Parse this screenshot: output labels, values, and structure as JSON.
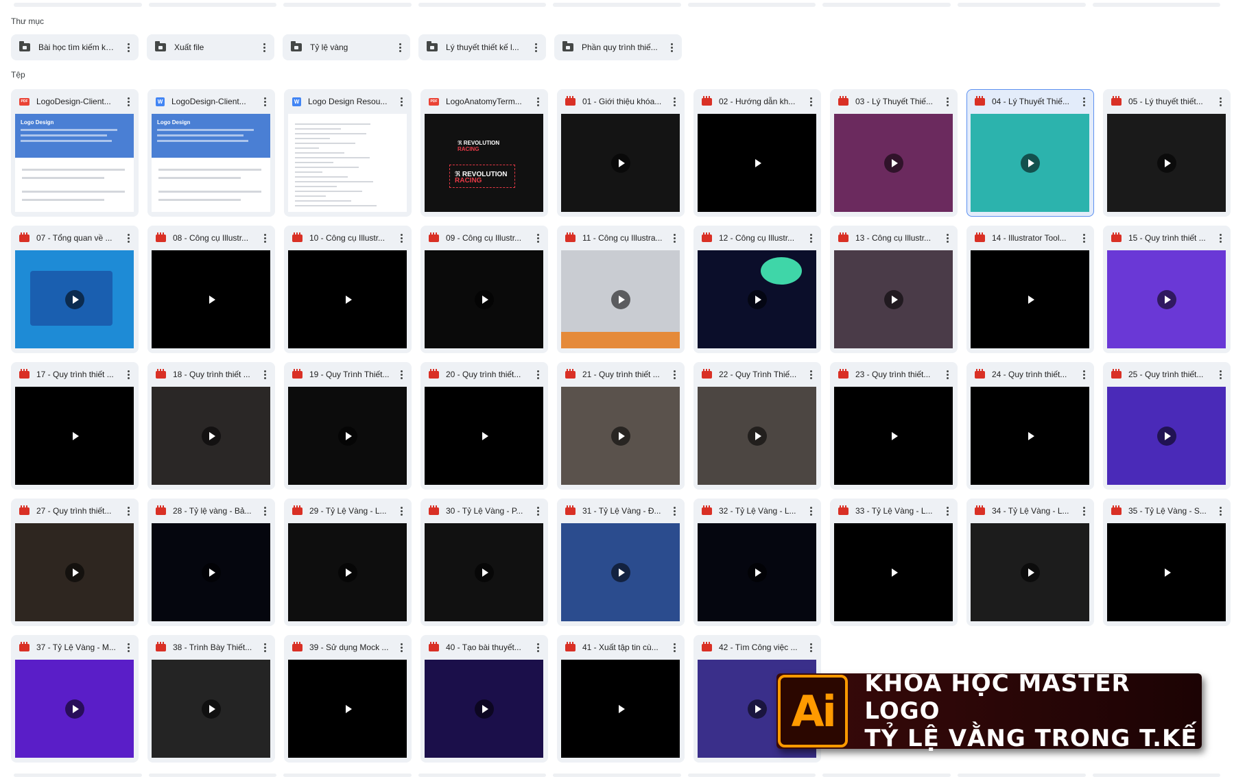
{
  "sections": {
    "folders_label": "Thư mục",
    "files_label": "Tệp"
  },
  "folders": [
    {
      "name": "Bài học tìm kiếm kh..."
    },
    {
      "name": "Xuất file"
    },
    {
      "name": "Tỷ lệ vàng"
    },
    {
      "name": "Lý thuyết thiết kế l..."
    },
    {
      "name": "Phần quy trình thiế..."
    }
  ],
  "files": [
    {
      "title": "LogoDesign-Client...",
      "type": "pdf",
      "thumb": "doc-blue"
    },
    {
      "title": "LogoDesign-Client...",
      "type": "word",
      "thumb": "doc-blue"
    },
    {
      "title": "Logo Design Resou...",
      "type": "word",
      "thumb": "doc-white"
    },
    {
      "title": "LogoAnatomyTerm...",
      "type": "pdf",
      "thumb": "anatomy"
    },
    {
      "title": "01 - Giới thiệu khóa...",
      "type": "video",
      "thumb": "#141414"
    },
    {
      "title": "02 - Hướng dẫn kh...",
      "type": "video",
      "thumb": "#000000"
    },
    {
      "title": "03 - Lý Thuyết Thiế...",
      "type": "video",
      "thumb": "#6b2a5e"
    },
    {
      "title": "04 - Lý Thuyết Thiế...",
      "type": "video",
      "thumb": "#2cb3ad",
      "selected": true
    },
    {
      "title": "05 - Lý thuyết thiết...",
      "type": "video",
      "thumb": "#1a1a1a"
    },
    {
      "title": "07 - Tổng quan về ...",
      "type": "video",
      "thumb": "#1e8bd6"
    },
    {
      "title": "08 - Công cụ Illustr...",
      "type": "video",
      "thumb": "#000000"
    },
    {
      "title": "10 - Công cụ Illustr...",
      "type": "video",
      "thumb": "#000000"
    },
    {
      "title": "09 - Công cụ Illustr...",
      "type": "video",
      "thumb": "#0a0a0a"
    },
    {
      "title": "11 - Công cụ Illustra...",
      "type": "video",
      "thumb": "#c9ccd2"
    },
    {
      "title": "12 - Công cụ Illustr...",
      "type": "video",
      "thumb": "#0b0e2a"
    },
    {
      "title": "13 - Công cụ Illustr...",
      "type": "video",
      "thumb": "#4a3b48"
    },
    {
      "title": "14 - Illustrator Tool...",
      "type": "video",
      "thumb": "#000000"
    },
    {
      "title": "15 - Quy trình thiết ...",
      "type": "video",
      "thumb": "#6a38d6"
    },
    {
      "title": "17 - Quy trình thiết ...",
      "type": "video",
      "thumb": "#000000"
    },
    {
      "title": "18 - Quy trình thiết ...",
      "type": "video",
      "thumb": "#2a2726"
    },
    {
      "title": "19 - Quy Trình Thiết...",
      "type": "video",
      "thumb": "#0c0c0c"
    },
    {
      "title": "20 - Quy trình thiết...",
      "type": "video",
      "thumb": "#000000"
    },
    {
      "title": "21 - Quy trình thiết ...",
      "type": "video",
      "thumb": "#5a524c"
    },
    {
      "title": "22 - Quy Trình Thiế...",
      "type": "video",
      "thumb": "#4c4642"
    },
    {
      "title": "23 - Quy trình thiết...",
      "type": "video",
      "thumb": "#000000"
    },
    {
      "title": "24 - Quy trình thiết...",
      "type": "video",
      "thumb": "#000000"
    },
    {
      "title": "25 - Quy trình thiết...",
      "type": "video",
      "thumb": "#4a2ab8"
    },
    {
      "title": "27 - Quy trình thiết...",
      "type": "video",
      "thumb": "#2e2620"
    },
    {
      "title": "28 - Tỷ lệ vàng - Bả...",
      "type": "video",
      "thumb": "#05060e"
    },
    {
      "title": "29 - Tỷ Lệ Vàng - L...",
      "type": "video",
      "thumb": "#0e0e0e"
    },
    {
      "title": "30 - Tỷ Lệ Vàng - P...",
      "type": "video",
      "thumb": "#111111"
    },
    {
      "title": "31 - Tỷ Lệ Vàng - Đ...",
      "type": "video",
      "thumb": "#2b4c8e"
    },
    {
      "title": "32 - Tỷ Lệ Vàng - L...",
      "type": "video",
      "thumb": "#05060f"
    },
    {
      "title": "33 - Tỷ Lệ Vàng - L...",
      "type": "video",
      "thumb": "#000000"
    },
    {
      "title": "34 - Tỷ Lệ Vàng - L...",
      "type": "video",
      "thumb": "#1c1c1c"
    },
    {
      "title": "35 - Tỷ Lệ Vàng - S...",
      "type": "video",
      "thumb": "#000000"
    },
    {
      "title": "37 - Tỷ Lệ Vàng - M...",
      "type": "video",
      "thumb": "#5a1ec8"
    },
    {
      "title": "38 - Trình Bày Thiết...",
      "type": "video",
      "thumb": "#242424"
    },
    {
      "title": "39 - Sử dụng Mock ...",
      "type": "video",
      "thumb": "#000000"
    },
    {
      "title": "40 - Tạo bài thuyết...",
      "type": "video",
      "thumb": "#1b0f4a"
    },
    {
      "title": "41 - Xuất tập tin cù...",
      "type": "video",
      "thumb": "#000000"
    },
    {
      "title": "42 - Tìm Công việc ...",
      "type": "video",
      "thumb": "#3a2f8a"
    }
  ],
  "banner": {
    "logo_text": "Ai",
    "line1": "KHÓA HỌC MASTER LOGO",
    "line2": "TỶ LỆ VẰNG TRONG T.KẾ",
    "accent": "#ff9a00"
  },
  "colors": {
    "video_icon": "#d93025",
    "doc_icon": "#4285f4",
    "selected_border": "#5b8ff0"
  }
}
